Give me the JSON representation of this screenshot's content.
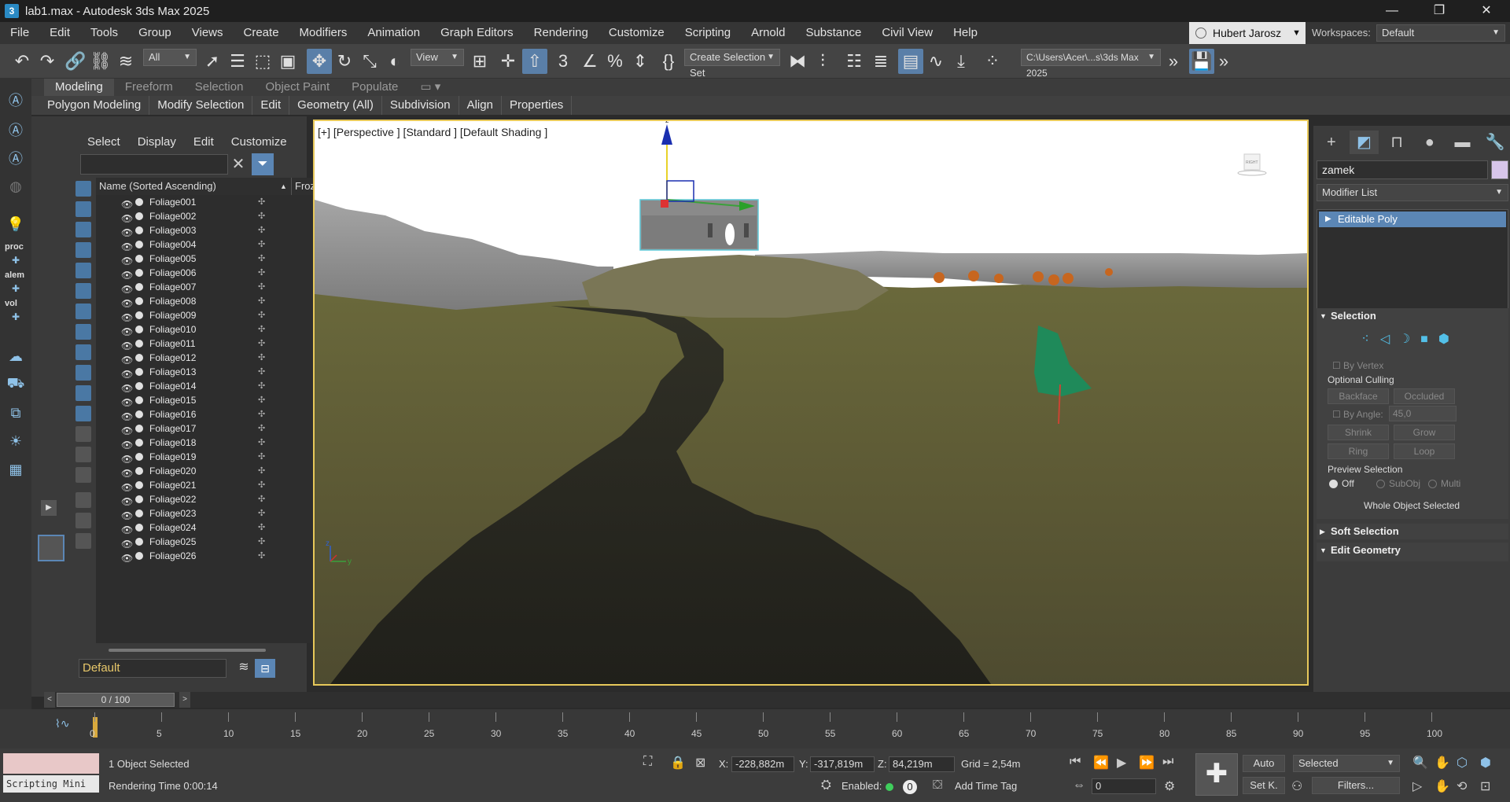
{
  "window": {
    "title": "lab1.max - Autodesk 3ds Max 2025",
    "app_icon": "3",
    "minimize": "—",
    "restore": "❐",
    "close": "✕"
  },
  "menu": {
    "items": [
      "File",
      "Edit",
      "Tools",
      "Group",
      "Views",
      "Create",
      "Modifiers",
      "Animation",
      "Graph Editors",
      "Rendering",
      "Customize",
      "Scripting",
      "Arnold",
      "Substance",
      "Civil View",
      "Help"
    ],
    "user": "Hubert Jarosz",
    "workspaces_label": "Workspaces:",
    "workspace": "Default"
  },
  "toolbar": {
    "selection_filter": "All",
    "ref_coord": "View",
    "selection_set": "Create Selection Set",
    "project_path": "C:\\Users\\Acer\\...s\\3ds Max 2025"
  },
  "ribbon": {
    "tabs": [
      "Modeling",
      "Freeform",
      "Selection",
      "Object Paint",
      "Populate"
    ],
    "subtabs": [
      "Polygon Modeling",
      "Modify Selection",
      "Edit",
      "Geometry (All)",
      "Subdivision",
      "Align",
      "Properties"
    ]
  },
  "left_strip": {
    "labels": [
      "proc",
      "alem",
      "vol"
    ]
  },
  "explorer": {
    "menu": [
      "Select",
      "Display",
      "Edit",
      "Customize"
    ],
    "col_name": "Name (Sorted Ascending)",
    "col_frozen": "Frozen",
    "sort_arrow": "▲",
    "items": [
      "Foliage001",
      "Foliage002",
      "Foliage003",
      "Foliage004",
      "Foliage005",
      "Foliage006",
      "Foliage007",
      "Foliage008",
      "Foliage009",
      "Foliage010",
      "Foliage011",
      "Foliage012",
      "Foliage013",
      "Foliage014",
      "Foliage015",
      "Foliage016",
      "Foliage017",
      "Foliage018",
      "Foliage019",
      "Foliage020",
      "Foliage021",
      "Foliage022",
      "Foliage023",
      "Foliage024",
      "Foliage025",
      "Foliage026"
    ],
    "layer": "Default"
  },
  "viewport": {
    "label": "[+] [Perspective ] [Standard ] [Default Shading ]",
    "viewcube_label": "RIGHT",
    "axis_z": "z",
    "axis_x": "x",
    "axis_y": "y"
  },
  "command_panel": {
    "object_name": "zamek",
    "object_color": "#d8c6ea",
    "modifier_list": "Modifier List",
    "stack_item": "Editable Poly",
    "selection": {
      "title": "Selection",
      "by_vertex": "By Vertex",
      "optional_culling": "Optional Culling",
      "backface": "Backface",
      "occluded": "Occluded",
      "by_angle": "By Angle:",
      "angle_value": "45,0",
      "shrink": "Shrink",
      "grow": "Grow",
      "ring": "Ring",
      "loop": "Loop",
      "preview_selection": "Preview Selection",
      "preview_options": [
        "Off",
        "SubObj",
        "Multi"
      ],
      "status": "Whole Object Selected"
    },
    "soft_selection": "Soft Selection",
    "edit_geometry": "Edit Geometry"
  },
  "timeline": {
    "position": "0 / 100",
    "ticks": [
      "0",
      "5",
      "10",
      "15",
      "20",
      "25",
      "30",
      "35",
      "40",
      "45",
      "50",
      "55",
      "60",
      "65",
      "70",
      "75",
      "80",
      "85",
      "90",
      "95",
      "100"
    ]
  },
  "status": {
    "script_label": "Scripting Mini",
    "selection_info": "1 Object Selected",
    "render_time": "Rendering Time  0:00:14",
    "x_label": "X:",
    "x_value": "-228,882m",
    "y_label": "Y:",
    "y_value": "-317,819m",
    "z_label": "Z:",
    "z_value": "84,219m",
    "grid": "Grid = 2,54m",
    "enabled_label": "Enabled:",
    "enabled_count": "0",
    "add_time_tag": "Add Time Tag",
    "auto": "Auto",
    "setk": "Set K.",
    "selected": "Selected",
    "filters": "Filters...",
    "frame": "0"
  }
}
